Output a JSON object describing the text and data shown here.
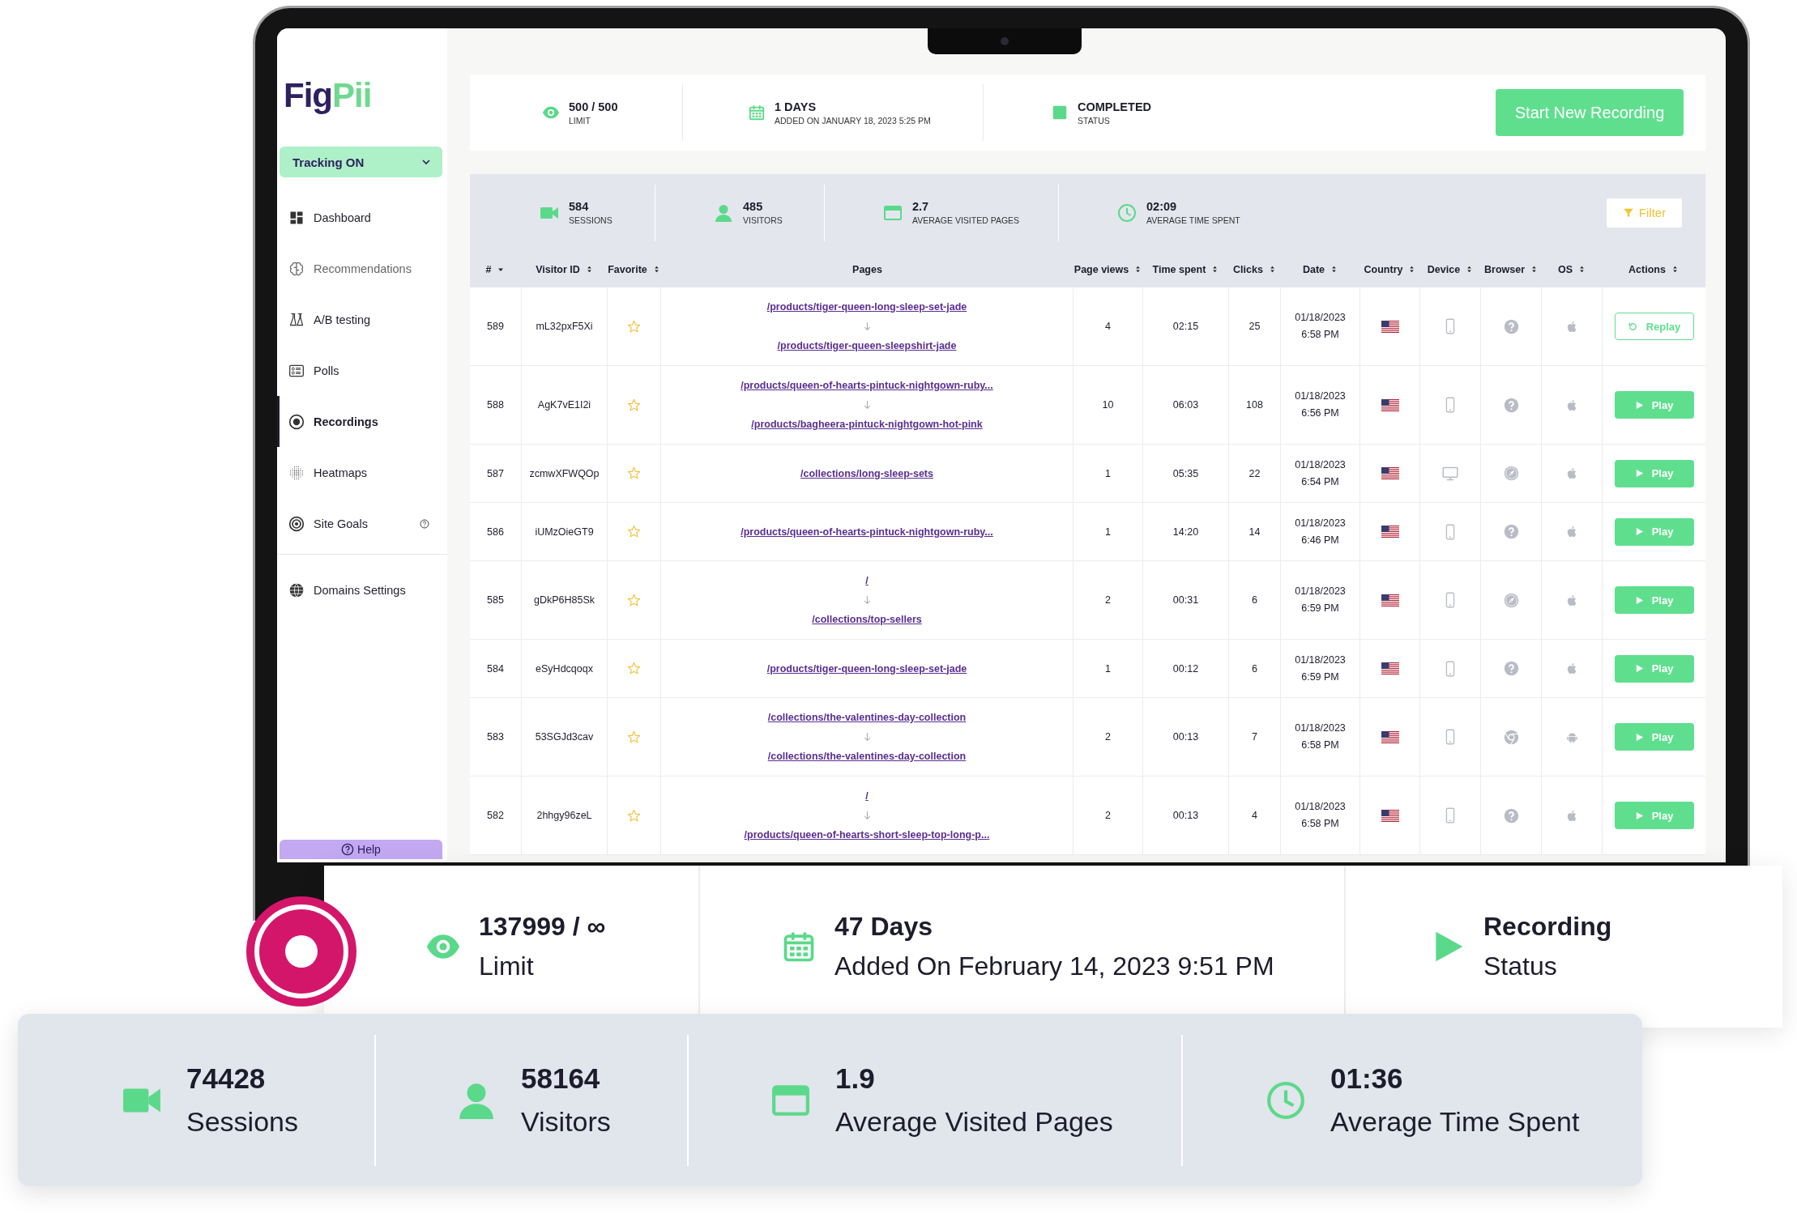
{
  "logo": {
    "first": "Fig",
    "second": "Pii"
  },
  "sidebar": {
    "tracking": "Tracking ON",
    "sections": [
      {
        "items": [
          {
            "kind": "dashboard",
            "label": "Dashboard",
            "selected": false,
            "disabled": false,
            "has_help": false
          },
          {
            "kind": "recommendations",
            "label": "Recommendations",
            "selected": false,
            "disabled": true,
            "has_help": false
          },
          {
            "kind": "ab_testing",
            "label": "A/B testing",
            "selected": false,
            "disabled": false,
            "has_help": false
          },
          {
            "kind": "polls",
            "label": "Polls",
            "selected": false,
            "disabled": false,
            "has_help": false
          },
          {
            "kind": "recordings",
            "label": "Recordings",
            "selected": true,
            "disabled": false,
            "has_help": false
          },
          {
            "kind": "heatmaps",
            "label": "Heatmaps",
            "selected": false,
            "disabled": false,
            "has_help": false
          },
          {
            "kind": "goals",
            "label": "Site Goals",
            "selected": false,
            "disabled": false,
            "has_help": true
          }
        ]
      },
      {
        "items": [
          {
            "kind": "domains",
            "label": "Domains Settings",
            "selected": false,
            "disabled": false,
            "has_help": false
          }
        ]
      }
    ],
    "help": "Help"
  },
  "summary": {
    "items": [
      {
        "kind": "limit",
        "value": "500 / 500",
        "label": "LIMIT"
      },
      {
        "kind": "days",
        "value": "1 DAYS",
        "label": "ADDED ON JANUARY 18, 2023 5:25 PM"
      },
      {
        "kind": "status",
        "value": "COMPLETED",
        "label": "STATUS"
      }
    ],
    "button": "Start New Recording"
  },
  "stats": {
    "items": [
      {
        "kind": "sessions",
        "value": "584",
        "label": "SESSIONS"
      },
      {
        "kind": "visitors",
        "value": "485",
        "label": "VISITORS"
      },
      {
        "kind": "pages",
        "value": "2.7",
        "label": "AVERAGE VISITED PAGES"
      },
      {
        "kind": "time",
        "value": "02:09",
        "label": "AVERAGE TIME SPENT"
      }
    ],
    "filter": "Filter"
  },
  "table": {
    "columns": [
      {
        "label": "#",
        "sortable": true,
        "sorted": true
      },
      {
        "label": "Visitor ID",
        "sortable": true,
        "sorted": false
      },
      {
        "label": "Favorite",
        "sortable": true,
        "sorted": false
      },
      {
        "label": "Pages",
        "sortable": false,
        "sorted": false
      },
      {
        "label": "Page views",
        "sortable": true,
        "sorted": false
      },
      {
        "label": "Time spent",
        "sortable": true,
        "sorted": false
      },
      {
        "label": "Clicks",
        "sortable": true,
        "sorted": false
      },
      {
        "label": "Date",
        "sortable": true,
        "sorted": false
      },
      {
        "label": "Country",
        "sortable": true,
        "sorted": false
      },
      {
        "label": "Device",
        "sortable": true,
        "sorted": false
      },
      {
        "label": "Browser",
        "sortable": true,
        "sorted": false
      },
      {
        "label": "OS",
        "sortable": true,
        "sorted": false
      },
      {
        "label": "Actions",
        "sortable": true,
        "sorted": false
      }
    ],
    "rows": [
      {
        "id": "589",
        "visitor": "mL32pxF5Xi",
        "favorite": false,
        "pages": [
          "/products/tiger-queen-long-sleep-set-jade",
          "/products/tiger-queen-sleepshirt-jade"
        ],
        "page_views": "4",
        "time_spent": "02:15",
        "clicks": "25",
        "date": "01/18/2023",
        "time": "6:58 PM",
        "device": {
          "kind": "mobile"
        },
        "browser": {
          "kind": "unknown"
        },
        "os": {
          "kind": "ios"
        },
        "action": {
          "kind": "replay",
          "label": "Replay"
        }
      },
      {
        "id": "588",
        "visitor": "AgK7vE1I2i",
        "favorite": false,
        "pages": [
          "/products/queen-of-hearts-pintuck-nightgown-ruby...",
          "/products/bagheera-pintuck-nightgown-hot-pink"
        ],
        "page_views": "10",
        "time_spent": "06:03",
        "clicks": "108",
        "date": "01/18/2023",
        "time": "6:56 PM",
        "device": {
          "kind": "mobile"
        },
        "browser": {
          "kind": "unknown"
        },
        "os": {
          "kind": "ios"
        },
        "action": {
          "kind": "play",
          "label": "Play"
        }
      },
      {
        "id": "587",
        "visitor": "zcmwXFWQOp",
        "favorite": false,
        "pages": [
          "/collections/long-sleep-sets"
        ],
        "page_views": "1",
        "time_spent": "05:35",
        "clicks": "22",
        "date": "01/18/2023",
        "time": "6:54 PM",
        "device": {
          "kind": "desktop"
        },
        "browser": {
          "kind": "safari"
        },
        "os": {
          "kind": "ios"
        },
        "action": {
          "kind": "play",
          "label": "Play"
        }
      },
      {
        "id": "586",
        "visitor": "iUMzOieGT9",
        "favorite": false,
        "pages": [
          "/products/queen-of-hearts-pintuck-nightgown-ruby..."
        ],
        "page_views": "1",
        "time_spent": "14:20",
        "clicks": "14",
        "date": "01/18/2023",
        "time": "6:46 PM",
        "device": {
          "kind": "mobile"
        },
        "browser": {
          "kind": "unknown"
        },
        "os": {
          "kind": "ios"
        },
        "action": {
          "kind": "play",
          "label": "Play"
        }
      },
      {
        "id": "585",
        "visitor": "gDkP6H85Sk",
        "favorite": false,
        "pages": [
          "/",
          "/collections/top-sellers"
        ],
        "page_views": "2",
        "time_spent": "00:31",
        "clicks": "6",
        "date": "01/18/2023",
        "time": "6:59 PM",
        "device": {
          "kind": "mobile"
        },
        "browser": {
          "kind": "safari"
        },
        "os": {
          "kind": "ios"
        },
        "action": {
          "kind": "play",
          "label": "Play"
        }
      },
      {
        "id": "584",
        "visitor": "eSyHdcqoqx",
        "favorite": false,
        "pages": [
          "/products/tiger-queen-long-sleep-set-jade"
        ],
        "page_views": "1",
        "time_spent": "00:12",
        "clicks": "6",
        "date": "01/18/2023",
        "time": "6:59 PM",
        "device": {
          "kind": "mobile"
        },
        "browser": {
          "kind": "unknown"
        },
        "os": {
          "kind": "ios"
        },
        "action": {
          "kind": "play",
          "label": "Play"
        }
      },
      {
        "id": "583",
        "visitor": "53SGJd3cav",
        "favorite": false,
        "pages": [
          "/collections/the-valentines-day-collection",
          "/collections/the-valentines-day-collection"
        ],
        "page_views": "2",
        "time_spent": "00:13",
        "clicks": "7",
        "date": "01/18/2023",
        "time": "6:58 PM",
        "device": {
          "kind": "mobile"
        },
        "browser": {
          "kind": "chrome"
        },
        "os": {
          "kind": "android"
        },
        "action": {
          "kind": "play",
          "label": "Play"
        }
      },
      {
        "id": "582",
        "visitor": "2hhgy96zeL",
        "favorite": false,
        "pages": [
          "/",
          "/products/queen-of-hearts-short-sleep-top-long-p..."
        ],
        "page_views": "2",
        "time_spent": "00:13",
        "clicks": "4",
        "date": "01/18/2023",
        "time": "6:58 PM",
        "device": {
          "kind": "mobile"
        },
        "browser": {
          "kind": "unknown"
        },
        "os": {
          "kind": "ios"
        },
        "action": {
          "kind": "play",
          "label": "Play"
        }
      }
    ]
  },
  "overlay": {
    "items": [
      {
        "kind": "limit",
        "value": "137999 / ∞",
        "label": "Limit"
      },
      {
        "kind": "days",
        "value": "47 Days",
        "label": "Added On February 14, 2023 9:51 PM"
      },
      {
        "kind": "status",
        "value": "Recording",
        "label": "Status"
      }
    ]
  },
  "overlay_stats": {
    "items": [
      {
        "kind": "sessions",
        "value": "74428",
        "label": "Sessions"
      },
      {
        "kind": "visitors",
        "value": "58164",
        "label": "Visitors"
      },
      {
        "kind": "pages",
        "value": "1.9",
        "label": "Average Visited Pages"
      },
      {
        "kind": "time",
        "value": "01:36",
        "label": "Average Time Spent"
      }
    ]
  }
}
